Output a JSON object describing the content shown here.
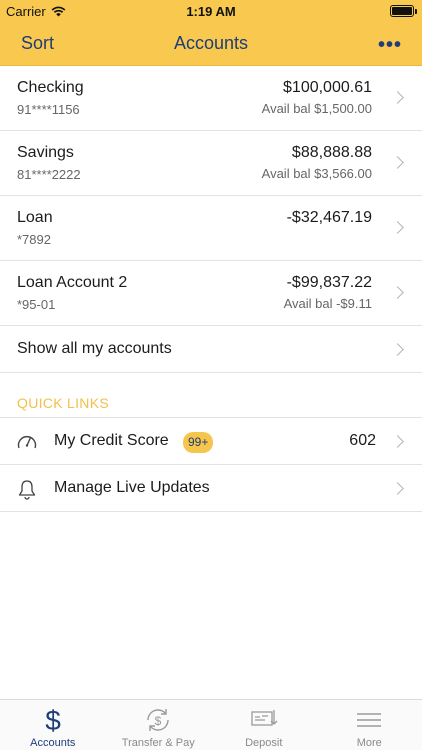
{
  "status_bar": {
    "carrier": "Carrier",
    "time": "1:19 AM"
  },
  "nav": {
    "left_button": "Sort",
    "title": "Accounts",
    "more": "•••"
  },
  "accounts": [
    {
      "name": "Checking",
      "number": "91****1156",
      "amount": "$100,000.61",
      "avail": "Avail bal $1,500.00"
    },
    {
      "name": "Savings",
      "number": "81****2222",
      "amount": "$88,888.88",
      "avail": "Avail bal $3,566.00"
    },
    {
      "name": "Loan",
      "number": "*7892",
      "amount": "-$32,467.19",
      "avail": ""
    },
    {
      "name": "Loan Account 2",
      "number": "*95-01",
      "amount": "-$99,837.22",
      "avail": "Avail bal -$9.11"
    }
  ],
  "show_all": "Show all my accounts",
  "quick_links": {
    "title": "QUICK LINKS",
    "items": [
      {
        "label": "My Credit Score",
        "badge": "99+",
        "value": "602",
        "icon": "gauge-icon"
      },
      {
        "label": "Manage Live Updates",
        "icon": "bell-icon"
      }
    ]
  },
  "tabs": [
    {
      "label": "Accounts",
      "icon": "dollar-icon",
      "active": true
    },
    {
      "label": "Transfer & Pay",
      "icon": "transfer-icon",
      "active": false
    },
    {
      "label": "Deposit",
      "icon": "check-deposit-icon",
      "active": false
    },
    {
      "label": "More",
      "icon": "menu-icon",
      "active": false
    }
  ],
  "colors": {
    "accent": "#f8c94e",
    "brand_blue": "#1f3d79",
    "quick_links_title": "#f2c14a"
  }
}
